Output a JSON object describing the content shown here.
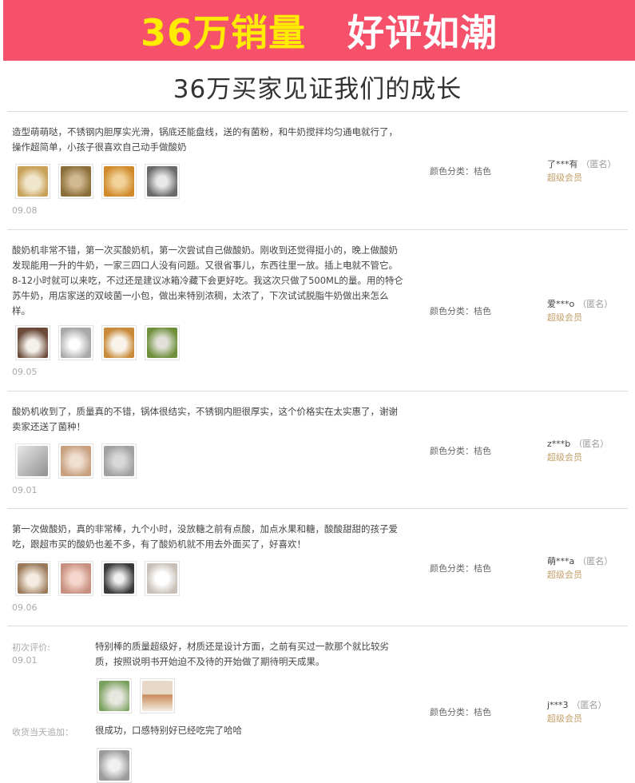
{
  "banner": {
    "left": "36万销量",
    "right": "好评如潮"
  },
  "headline": "36万买家见证我们的成长",
  "color_label": "颜色分类：桔色",
  "level_label": "超级会员",
  "reviews": [
    {
      "text": "造型萌萌哒，不锈钢内胆厚实光滑，锅底还能盘线，送的有菌粉，和牛奶搅拌均匀通电就行了，操作超简单，小孩子很喜欢自己动手做酸奶",
      "date": "09.08",
      "user": "了***有",
      "anon": "（匿名）"
    },
    {
      "text": "酸奶机非常不错，第一次买酸奶机，第一次尝试自己做酸奶。刚收到还觉得挺小的，晚上做酸奶发现能用一升的牛奶，一家三四口人没有问题。又很省事儿，东西往里一放。插上电就不管它。8-12小时就可以来吃，不过还是建议冰箱冷藏下会更好吃。我这次只做了500ML的量。用的特仑苏牛奶，用店家送的双岐菌一小包，做出来特别浓稠，太浓了，下次试试脱脂牛奶做出来怎么样。",
      "date": "09.05",
      "user": "爱***o",
      "anon": "（匿名）"
    },
    {
      "text": "酸奶机收到了，质量真的不错，锅体很结实，不锈钢内胆很厚实，这个价格实在太实惠了，谢谢卖家还送了菌种！",
      "date": "09.01",
      "user": "z***b",
      "anon": "（匿名）"
    },
    {
      "text": "第一次做酸奶，真的非常棒，九个小时，没放糖之前有点酸，加点水果和糖，酸酸甜甜的孩子爱吃，跟超市买的酸奶也差不多，有了酸奶机就不用去外面买了，好喜欢！",
      "date": "09.06",
      "user": "萌***a",
      "anon": "（匿名）"
    },
    {
      "first_label": "初次评价:",
      "first_date": "09.01",
      "first_text": "特别棒的质量超级好，材质还是设计方面，之前有买过一款那个就比较劣质，按照说明书开始迫不及待的开始做了期待明天成果。",
      "append_label": "收货当天追加：",
      "append_text": "很成功，口感特别好已经吃完了哈哈",
      "user": "j***3",
      "anon": "（匿名）"
    }
  ],
  "thumb_colors": {
    "r1": [
      "#c9a25a",
      "#8b6f3a",
      "#d08a2a",
      "#9a9a9a"
    ],
    "r2": [
      "#6b4a3a",
      "#d8d8d8",
      "#c98a3a",
      "#6f8f3a"
    ],
    "r3": [
      "#b0b0b0",
      "#c8a080",
      "#a0a0a0"
    ],
    "r4": [
      "#9a7a5a",
      "#e0b0a8",
      "#6a6a6a",
      "#e8e0d8"
    ],
    "r5a": [
      "#7aa060",
      "#c88a5a"
    ],
    "r5b": [
      "#9a9a9a"
    ]
  }
}
